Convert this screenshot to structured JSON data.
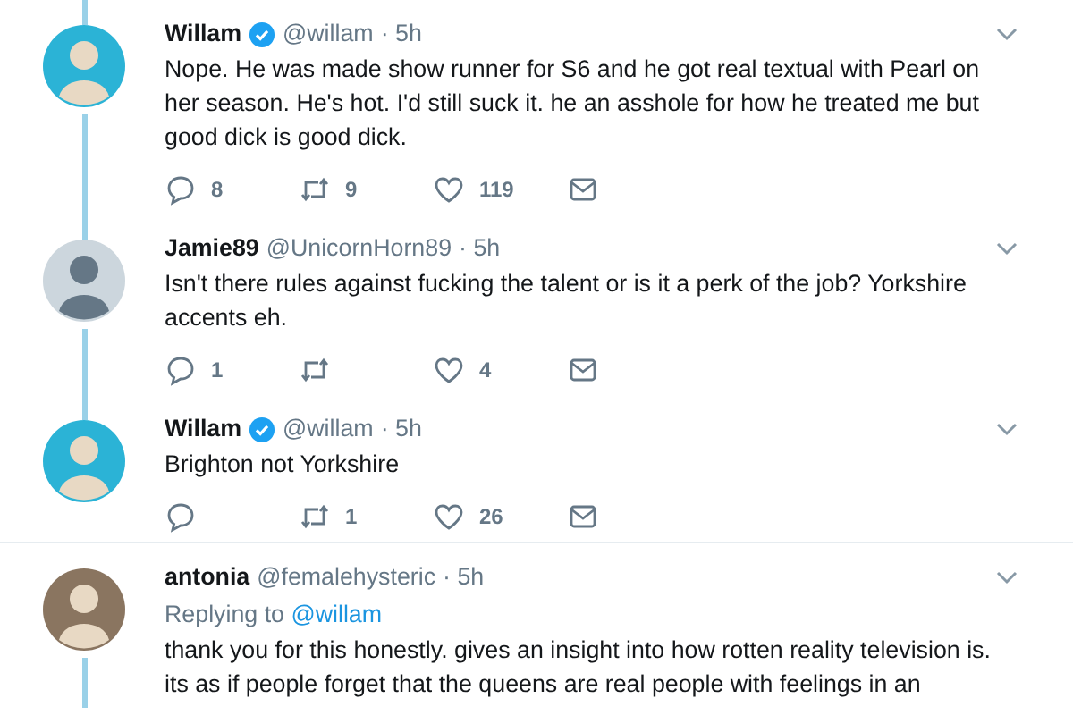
{
  "threads": [
    {
      "continues_above": true,
      "tweets": [
        {
          "name": "Willam",
          "verified": true,
          "handle": "@willam",
          "time": "· 5h",
          "color": "#2bb3d6",
          "text": "Nope. He was made show runner for S6 and he got real textual with Pearl on her season. He's hot. I'd still suck it. he an asshole for how he treated me but good dick is good dick.",
          "replies": "8",
          "retweets": "9",
          "likes": "119"
        },
        {
          "name": "Jamie89",
          "verified": false,
          "handle": "@UnicornHorn89",
          "time": "· 5h",
          "color": "#ccd6dd",
          "text": "Isn't there rules against fucking the talent or is it a perk of the job? Yorkshire accents eh.",
          "replies": "1",
          "likes": "4"
        },
        {
          "name": "Willam",
          "verified": true,
          "handle": "@willam",
          "time": "· 5h",
          "color": "#2bb3d6",
          "text": "Brighton not Yorkshire",
          "retweets": "1",
          "likes": "26"
        }
      ]
    },
    {
      "continues_below": true,
      "tweets": [
        {
          "name": "antonia",
          "verified": false,
          "handle": "@femalehysteric",
          "time": "· 5h",
          "color": "#8a7560",
          "replying_label": "Replying to",
          "replying_to": "@willam",
          "text": "thank you for this honestly. gives an insight into how rotten reality television is. its as if people forget that the queens are real people with feelings in an"
        }
      ]
    }
  ]
}
